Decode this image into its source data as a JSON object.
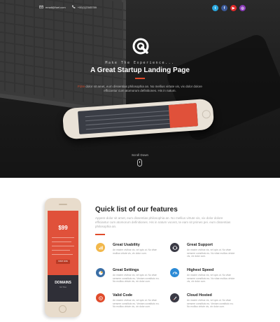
{
  "topbar": {
    "email": "email@fuel.com",
    "phone": "+00(1)2345789"
  },
  "social": [
    {
      "name": "twitter",
      "glyph": "t",
      "color": "#2aa9e0"
    },
    {
      "name": "facebook",
      "glyph": "f",
      "color": "#3b5998"
    },
    {
      "name": "youtube",
      "glyph": "▶",
      "color": "#e02a2a"
    },
    {
      "name": "instagram",
      "glyph": "◎",
      "color": "#8a3ab9"
    }
  ],
  "hero": {
    "tagline": "Make The Experience...",
    "title": "A Great Startup Landing Page",
    "text_highlight": "Fizre",
    "text_rest": " dolor sit amet, eum dissentias philosophia an. No mellius virtute vis, vix dolor dolore efficiantur cum atomorum definitiones. His in natum.",
    "scroll_label": "Scroll Down",
    "accent": "#e04b2b"
  },
  "phone_card": {
    "price": "$99",
    "price_cents": "99",
    "order_button": "SHOP NOW",
    "dark_title": "DOMAINS",
    "dark_subtitle": "for You"
  },
  "features": {
    "title": "Quick list of our features",
    "intro": "Appere dolor sit amet, eum dissentias philosophia an. No mellius virtute vis, vix dolor dolore efficiantur cum atomorum definitiones. His in natum vocent, te eam sit primes pei. eum dissentias philosophia an.",
    "items": [
      {
        "title": "Great Usability",
        "desc": "An mazim civibus vis, vel quis ut. No vitae mollius virtute vis, vix dolor cum.",
        "icon": "chart-icon",
        "color": "#f2b84b"
      },
      {
        "title": "Great Support",
        "desc": "An mazim civibus vis, vel quis ut. No vitae sensere constituto eu. No vitae mollius virtute vis, vix dolor cum.",
        "icon": "support-icon",
        "color": "#3a3a45"
      },
      {
        "title": "Great Settings",
        "desc": "An mazim civibus vis, vel quis ut. No vitae sensere constituto eu. Veniam constituto eu. No mollius virtute vis, vix dolor cum.",
        "icon": "pie-icon",
        "color": "#3a6ea5"
      },
      {
        "title": "Highest Speed",
        "desc": "An mazim civibus vis, vel quis ut. No vitae sensere constituto eu. No vitae mollius virtute vis, vix dolor cum.",
        "icon": "speed-icon",
        "color": "#2b8ad6"
      },
      {
        "title": "Valid Code",
        "desc": "An mazim civibus vis, vel quis ut. No vitae sensere constituto eu. Veniam constituto eu. No mollius virtute vis, vix dolor cum.",
        "icon": "code-icon",
        "color": "#e04b2b"
      },
      {
        "title": "Cloud Hosted",
        "desc": "An mazim civibus vis, vel quis ut. No vitae sensere constituto eu. Veniam constituto eu. No mollius virtute vis, vix dolor cum.",
        "icon": "rocket-icon",
        "color": "#3a3a45"
      }
    ]
  }
}
